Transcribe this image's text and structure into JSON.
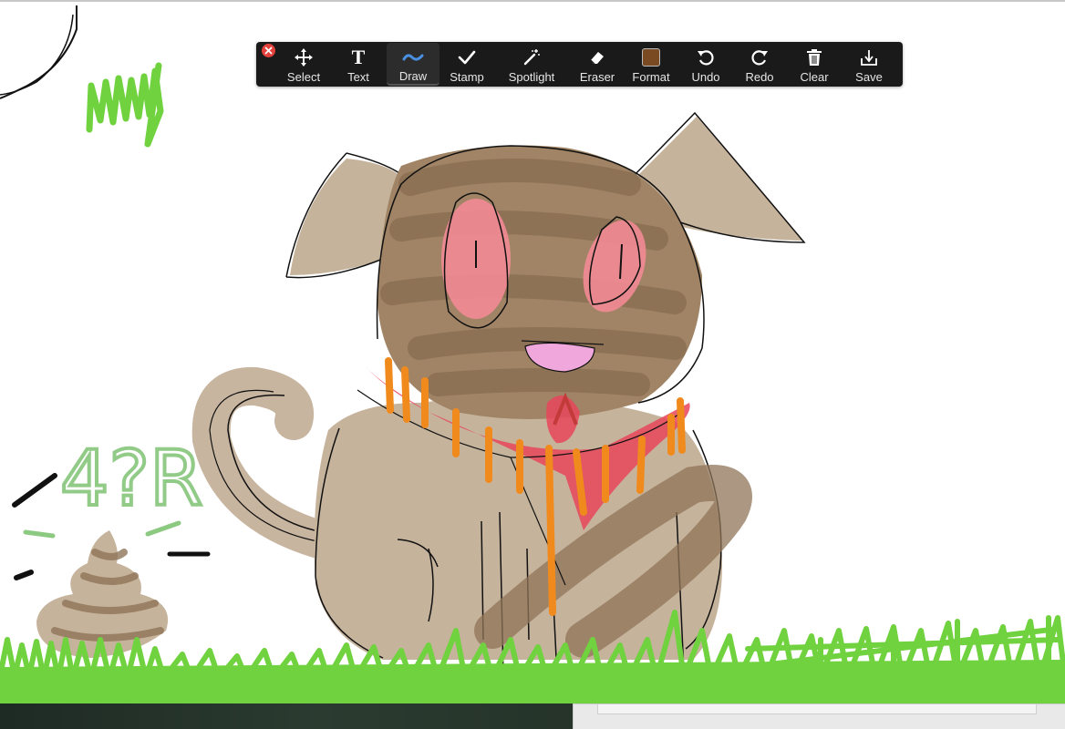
{
  "toolbar": {
    "tools": [
      {
        "id": "select",
        "label": "Select",
        "icon": "move-arrows-icon"
      },
      {
        "id": "text",
        "label": "Text",
        "icon": "text-t-icon"
      },
      {
        "id": "draw",
        "label": "Draw",
        "icon": "squiggle-icon",
        "active": true
      },
      {
        "id": "stamp",
        "label": "Stamp",
        "icon": "checkmark-icon"
      },
      {
        "id": "spotlight",
        "label": "Spotlight",
        "icon": "magic-wand-icon"
      },
      {
        "id": "eraser",
        "label": "Eraser",
        "icon": "eraser-icon"
      },
      {
        "id": "format",
        "label": "Format",
        "icon": "color-swatch-icon"
      },
      {
        "id": "undo",
        "label": "Undo",
        "icon": "undo-arrow-icon"
      },
      {
        "id": "redo",
        "label": "Redo",
        "icon": "redo-arrow-icon"
      },
      {
        "id": "clear",
        "label": "Clear",
        "icon": "trash-icon"
      },
      {
        "id": "save",
        "label": "Save",
        "icon": "download-tray-icon"
      }
    ],
    "close_icon": "close-x-icon"
  },
  "colors": {
    "toolbar_bg": "#1a1a1a",
    "draw_active": "#4a90e2",
    "format_swatch": "#7a4a22",
    "close_red": "#e2413b",
    "dog_fill": "#a08465",
    "grass": "#5fce2f",
    "ear_pink": "#f28b95",
    "bandana_red": "#e8455a",
    "stripe_orange": "#f08a1d",
    "soft_green": "#8cc981"
  },
  "canvas": {
    "handwritten_letters": "4?R"
  }
}
